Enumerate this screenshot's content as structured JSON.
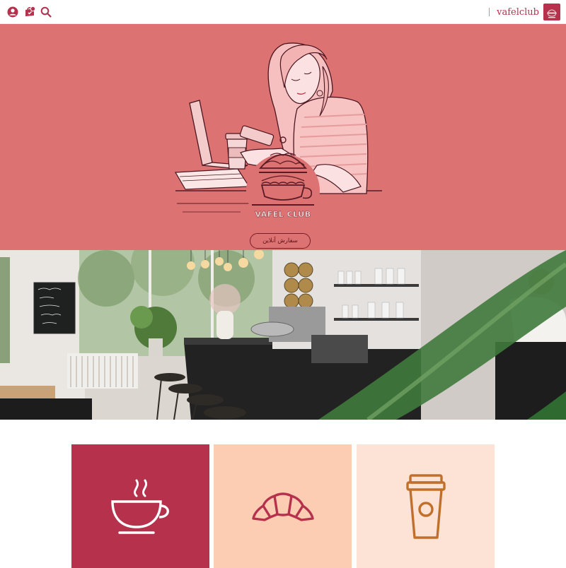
{
  "header": {
    "brand_name": "vafelclub",
    "icons": [
      "account-icon",
      "cart-icon",
      "search-icon"
    ]
  },
  "hero": {
    "logo_text": "VAFEL CLUB",
    "order_button_label": "سفارش آنلاین",
    "background_color": "#dd7272"
  },
  "categories": [
    {
      "name": "hot-drinks",
      "icon": "coffee-cup-icon",
      "color": "#b5314c"
    },
    {
      "name": "pastries",
      "icon": "croissant-icon",
      "color": "#fccdb2"
    },
    {
      "name": "takeaway",
      "icon": "takeaway-cup-icon",
      "color": "#fde3d6"
    }
  ],
  "colors": {
    "brand": "#b5314c",
    "hero": "#dd7272",
    "icon_stroke_dark": "#b5314c",
    "icon_stroke_orange": "#c0702a"
  }
}
